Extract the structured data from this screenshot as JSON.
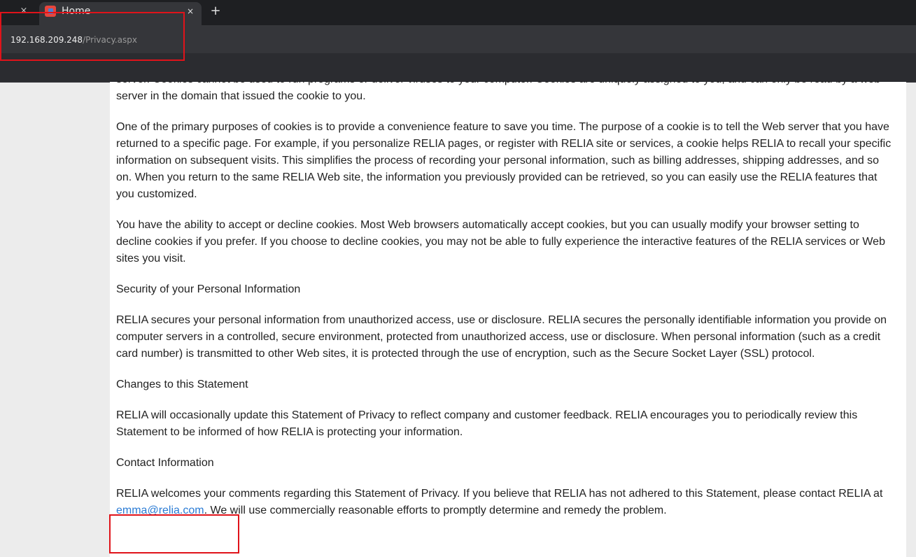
{
  "browser": {
    "active_tab": {
      "title": "Home",
      "close_glyph": "×"
    },
    "previous_tab_close_glyph": "×",
    "new_tab_glyph": "+",
    "address_bar": {
      "host": "192.168.209.248",
      "path": "/Privacy.aspx"
    }
  },
  "privacy": {
    "cookies_cont": "server. Cookies cannot be used to run programs or deliver viruses to your computer. Cookies are uniquely assigned to you, and can only be read by a web server in the domain that issued the cookie to you.",
    "cookies_purpose": "One of the primary purposes of cookies is to provide a convenience feature to save you time. The purpose of a cookie is to tell the Web server that you have returned to a specific page. For example, if you personalize RELIA pages, or register with RELIA site or services, a cookie helps RELIA to recall your specific information on subsequent visits. This simplifies the process of recording your personal information, such as billing addresses, shipping addresses, and so on. When you return to the same RELIA Web site, the information you previously provided can be retrieved, so you can easily use the RELIA features that you customized.",
    "cookies_choice": "You have the ability to accept or decline cookies. Most Web browsers automatically accept cookies, but you can usually modify your browser setting to decline cookies if you prefer. If you choose to decline cookies, you may not be able to fully experience the interactive features of the RELIA services or Web sites you visit.",
    "security_heading": "Security of your Personal Information",
    "security_text": "RELIA secures your personal information from unauthorized access, use or disclosure. RELIA secures the personally identifiable information you provide on computer servers in a controlled, secure environment, protected from unauthorized access, use or disclosure. When personal information (such as a credit card number) is transmitted to other Web sites, it is protected through the use of encryption, such as the Secure Socket Layer (SSL) protocol.",
    "changes_heading": "Changes to this Statement",
    "changes_text": "RELIA will occasionally update this Statement of Privacy to reflect company and customer feedback. RELIA encourages you to periodically review this Statement to be informed of how RELIA is protecting your information.",
    "contact_heading": "Contact Information",
    "contact_before": "RELIA welcomes your comments regarding this Statement of Privacy. If you believe that RELIA has not adhered to this Statement, please contact RELIA at ",
    "contact_email": "emma@relia.com",
    "contact_after": ". We will use commercially reasonable efforts to promptly determine and remedy the problem."
  }
}
